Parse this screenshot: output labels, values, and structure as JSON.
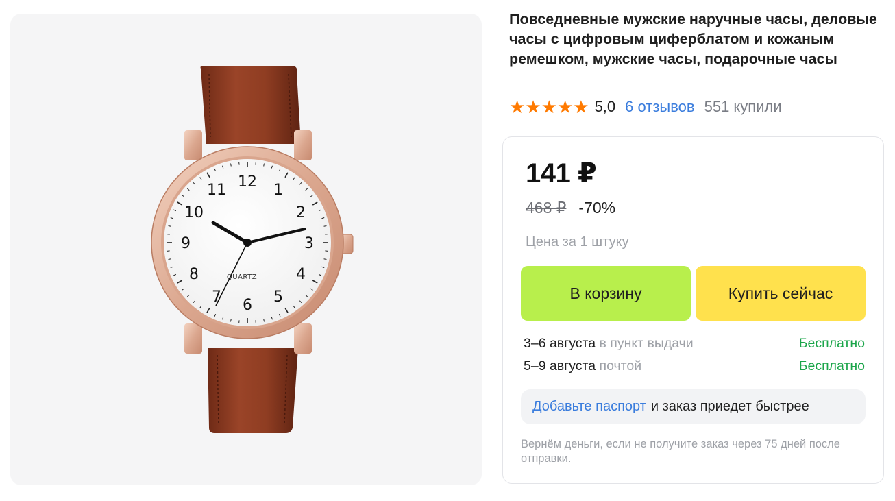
{
  "product": {
    "title": "Повседневные мужские наручные часы, деловые часы с цифровым циферблатом и кожаным ремешком, мужские часы, подарочные часы",
    "rating": {
      "value": "5,0",
      "stars": 5,
      "reviews_label": "6 отзывов",
      "bought_label": "551 купили"
    },
    "image": {
      "dial_brand": "QUARTZ",
      "dial_numbers": [
        "12",
        "1",
        "2",
        "3",
        "4",
        "5",
        "6",
        "7",
        "8",
        "9",
        "10",
        "11"
      ],
      "strap_color": "#8a3a22",
      "case_color": "#e2b39d"
    }
  },
  "pricing": {
    "price": "141 ₽",
    "old_price": "468 ₽",
    "discount": "-70%",
    "unit_note": "Цена за 1 штуку"
  },
  "actions": {
    "cart_label": "В корзину",
    "buy_label": "Купить сейчас"
  },
  "delivery": [
    {
      "date": "3–6 августа",
      "method": " в пункт выдачи",
      "price": "Бесплатно"
    },
    {
      "date": "5–9 августа",
      "method": " почтой",
      "price": "Бесплатно"
    }
  ],
  "passport": {
    "link": "Добавьте паспорт",
    "text": "и заказ приедет быстрее"
  },
  "refund_note": "Вернём деньги, если не получите заказ через 75 дней после отправки.",
  "colors": {
    "star": "#ff7a00",
    "link": "#3b7ddd",
    "cart_button": "#b8ef4c",
    "buy_button": "#ffe14d",
    "free_delivery": "#1aa549"
  }
}
